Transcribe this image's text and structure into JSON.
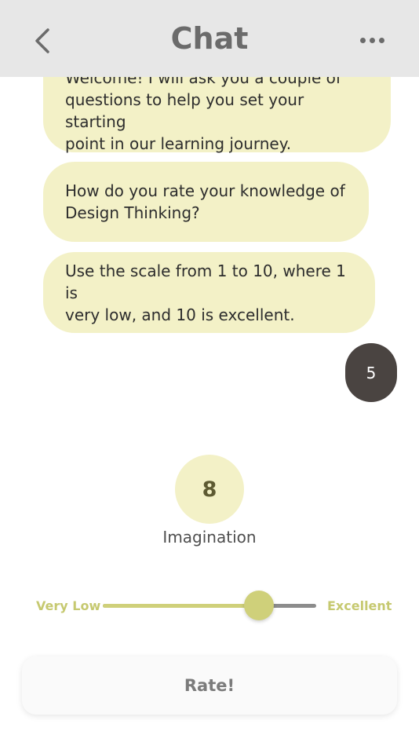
{
  "header": {
    "title": "Chat",
    "back_icon": "chevron-left-icon",
    "more_icon": "more-horizontal-icon"
  },
  "messages": [
    {
      "lines": [
        "Welcome! I will ask you a couple of",
        "questions to help you set your starting",
        "point in our learning journey."
      ]
    },
    {
      "lines": [
        "How do you rate your knowledge of",
        "Design Thinking?"
      ]
    },
    {
      "lines": [
        "Use the scale from 1 to 10, where 1 is",
        "very low, and 10 is excellent."
      ]
    }
  ],
  "user_reply": "5",
  "rating": {
    "value": "8",
    "label": "Imagination",
    "min_label": "Very Low",
    "max_label": "Excellent",
    "slider_fraction": 0.73
  },
  "rate_button": "Rate!",
  "colors": {
    "accent": "#cfd07a",
    "bubble": "#f3f1c7",
    "reply_bubble": "#4a4441",
    "header_bg": "#e7e7e7"
  }
}
